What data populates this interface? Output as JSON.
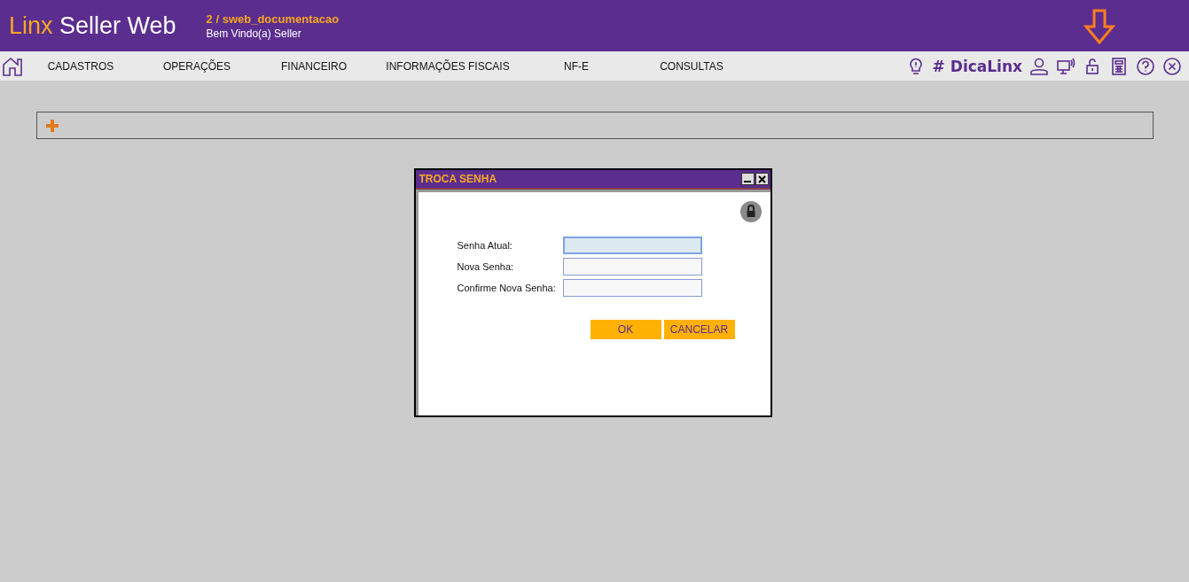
{
  "header": {
    "brand_first": "Linx",
    "brand_rest": "Seller Web",
    "company": "2 / sweb_documentacao",
    "welcome": "Bem Vindo(a) Seller"
  },
  "menu": [
    "CADASTROS",
    "OPERAÇÕES",
    "FINANCEIRO",
    "INFORMAÇÕES FISCAIS",
    "NF-E",
    "CONSULTAS"
  ],
  "tip_tag": "# DicaLinx",
  "dialog": {
    "title": "TROCA SENHA",
    "fields": [
      {
        "label": "Senha Atual:",
        "focused": true
      },
      {
        "label": "Nova Senha:",
        "focused": false
      },
      {
        "label": "Confirme Nova Senha:",
        "focused": false
      }
    ],
    "buttons": [
      "OK",
      "CANCELAR"
    ]
  }
}
